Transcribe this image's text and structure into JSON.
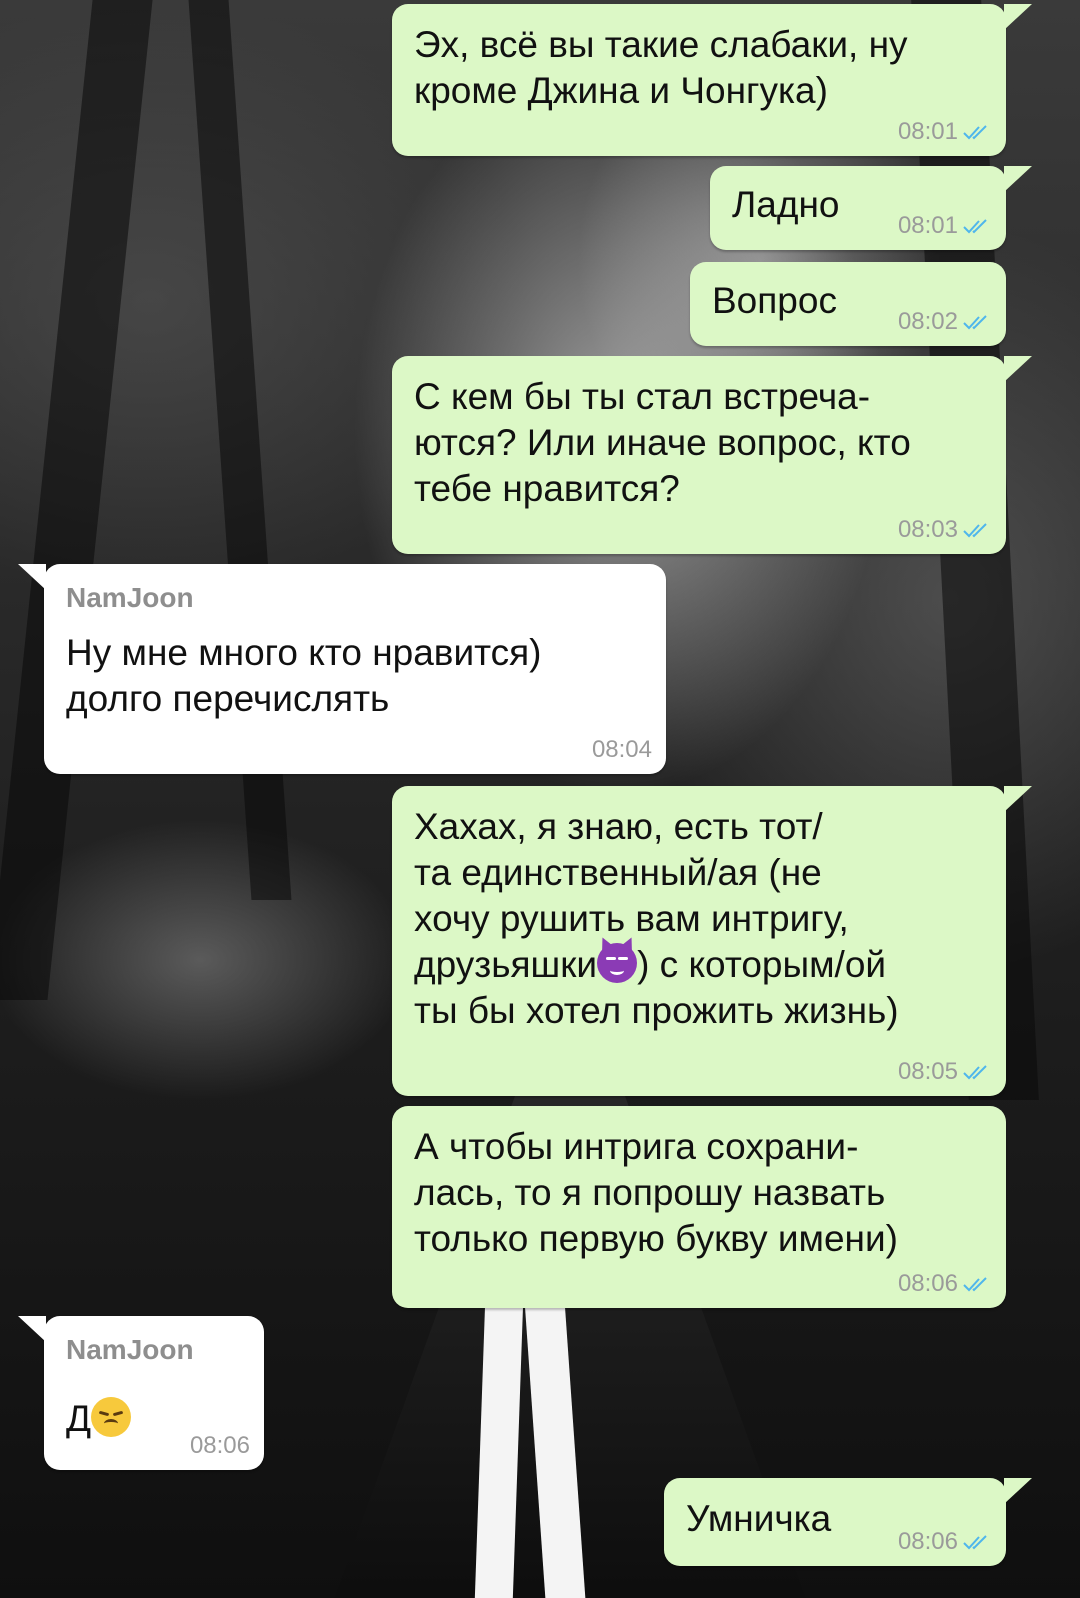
{
  "colors": {
    "outgoing_bubble": "#dcf8c6",
    "incoming_bubble": "#ffffff",
    "read_ticks": "#4fb6ec",
    "sender_name": "#8e8e8e"
  },
  "messages": [
    {
      "direction": "out",
      "text": "Эх, всё вы такие слабаки, ну\nкроме Джина и Чонгука)",
      "time": "08:01",
      "status_icon": "double-check-icon"
    },
    {
      "direction": "out",
      "text": "Ладно",
      "time": "08:01",
      "status_icon": "double-check-icon"
    },
    {
      "direction": "out",
      "text": "Вопрос",
      "time": "08:02",
      "status_icon": "double-check-icon"
    },
    {
      "direction": "out",
      "text": "С кем бы ты стал встреча-\nются? Или иначе вопрос, кто\nтебе нравится?",
      "time": "08:03",
      "status_icon": "double-check-icon"
    },
    {
      "direction": "in",
      "sender": "NamJoon",
      "text": "Ну мне много кто нравится)\nдолго перечислять",
      "time": "08:04"
    },
    {
      "direction": "out",
      "text_before_emoji": "Хахах, я знаю, есть тот/\nта единственный/ая (не\nхочу рушить вам интригу,\nдрузьяшки",
      "emoji": "smiling-devil-emoji",
      "text_after_emoji": ") с которым/ой\nты бы хотел прожить жизнь)",
      "time": "08:05",
      "status_icon": "double-check-icon"
    },
    {
      "direction": "out",
      "text": "А чтобы интрига сохрани-\nлась, то я попрошу назвать\nтолько первую букву имени)",
      "time": "08:06",
      "status_icon": "double-check-icon"
    },
    {
      "direction": "in",
      "sender": "NamJoon",
      "text": "Д",
      "emoji": "pensive-face-emoji",
      "time": "08:06"
    },
    {
      "direction": "out",
      "text": "Умничка",
      "time": "08:06",
      "status_icon": "double-check-icon"
    }
  ]
}
